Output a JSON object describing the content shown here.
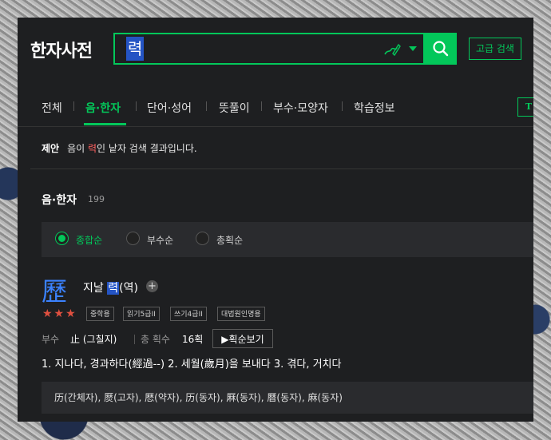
{
  "header": {
    "logo": "한자사전",
    "search_value": "력",
    "advanced_label": "고급 검색"
  },
  "tabs": [
    {
      "label": "전체"
    },
    {
      "label": "음·한자"
    },
    {
      "label": "단어·성어"
    },
    {
      "label": "뜻풀이"
    },
    {
      "label": "부수·모양자"
    },
    {
      "label": "학습정보"
    }
  ],
  "t_badge": "T",
  "suggestion": {
    "label": "제안",
    "prefix": "음이 ",
    "highlight": "력",
    "suffix": "인 낱자 검색 결과입니다."
  },
  "section": {
    "title": "음·한자",
    "count": "199"
  },
  "sort": [
    {
      "label": "종합순",
      "selected": true
    },
    {
      "label": "부수순",
      "selected": false
    },
    {
      "label": "총획순",
      "selected": false
    }
  ],
  "entry": {
    "hanja": "歷",
    "meaning_prefix": "지날 ",
    "reading": "력",
    "meaning_suffix": "(역)",
    "stars": "★★★",
    "tags": [
      "중학용",
      "읽기5급II",
      "쓰기4급II",
      "대법원인명용"
    ],
    "radical_label": "부수",
    "radical_value": "止 (그칠지)",
    "strokes_label": "총 획수",
    "strokes_value": "16획",
    "stroke_button": "▶획순보기",
    "definitions": "1. 지나다, 경과하다(經過--)  2. 세월(歲月)을 보내다  3. 겪다, 거치다",
    "variants": "历(간체자), 㷴(고자), 厯(약자), 历(동자), 厤(동자), 曆(동자), 麻(동자)"
  }
}
